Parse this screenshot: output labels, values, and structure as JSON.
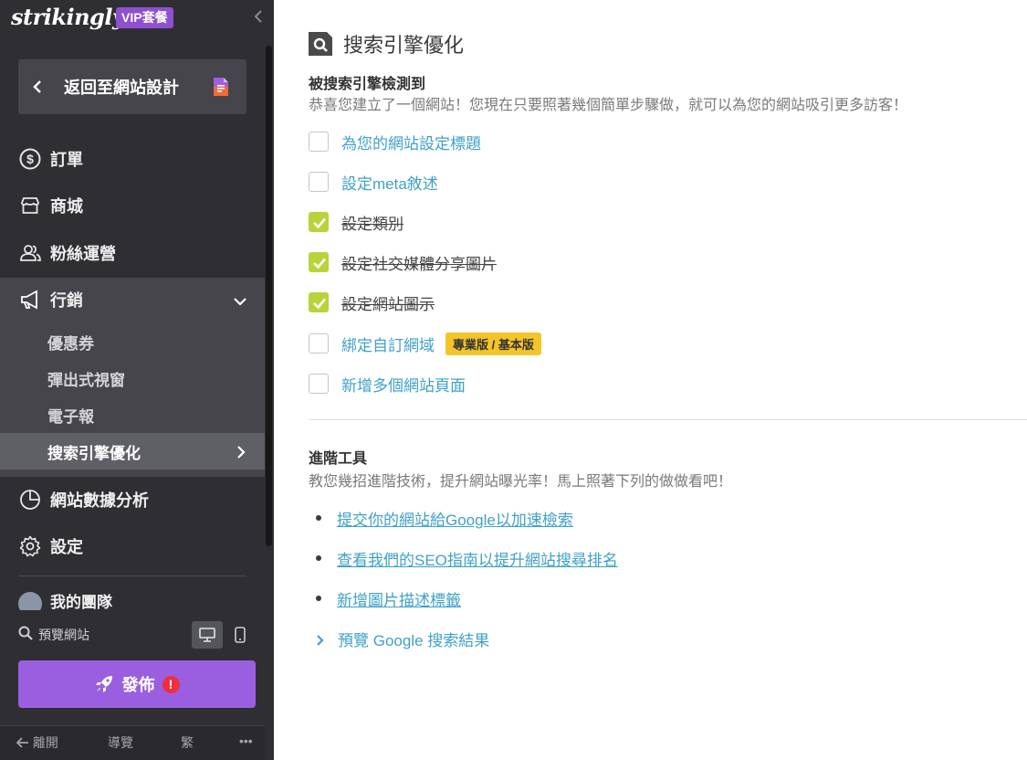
{
  "sidebar": {
    "logo": "strikingly",
    "vip_badge": "VIP套餐",
    "back_label": "返回至網站設計",
    "nav": {
      "orders": "訂單",
      "store": "商城",
      "fans": "粉絲運營",
      "marketing": "行銷",
      "analytics": "網站數據分析",
      "settings": "設定"
    },
    "marketing_sub": {
      "coupons": "優惠券",
      "popup": "彈出式視窗",
      "newsletter": "電子報",
      "seo": "搜索引擎優化"
    },
    "team": "我的團隊",
    "preview_label": "預覽網站",
    "publish_label": "發佈",
    "publish_alert": "!",
    "bottom": {
      "leave": "離開",
      "guide": "導覽",
      "lang": "繁",
      "more": "•••"
    }
  },
  "main": {
    "title": "搜索引擎優化",
    "detect": {
      "heading": "被搜索引擎檢測到",
      "description": "恭喜您建立了一個網站！您現在只要照著幾個簡單步驟做，就可以為您的網站吸引更多訪客！"
    },
    "checklist": [
      {
        "label": "為您的網站設定標題",
        "done": false
      },
      {
        "label": "設定meta敘述",
        "done": false
      },
      {
        "label": "設定類別",
        "done": true
      },
      {
        "label": "設定社交媒體分享圖片",
        "done": true
      },
      {
        "label": "設定網站圖示",
        "done": true
      },
      {
        "label": "綁定自訂網域",
        "done": false,
        "badge": "專業版 / 基本版"
      },
      {
        "label": "新增多個網站頁面",
        "done": false
      }
    ],
    "advanced": {
      "heading": "進階工具",
      "description": "教您幾招進階技術，提升網站曝光率！馬上照著下列的做做看吧！",
      "links": [
        "提交你的網站給Google以加速檢索",
        "查看我們的SEO指南以提升網站搜尋排名",
        "新增圖片描述標籤"
      ],
      "preview_google": "預覽 Google 搜索結果"
    }
  },
  "colors": {
    "sidebar_bg": "#2f2f33",
    "active_bg": "#45454b",
    "accent_purple": "#9a5fe0",
    "link_blue": "#3fa1c7",
    "check_green": "#b8d43a",
    "badge_yellow": "#f4c42b",
    "alert_red": "#ef2f3d"
  },
  "icons": {
    "orders": "dollar-circle-icon",
    "store": "storefront-icon",
    "fans": "people-icon",
    "marketing": "megaphone-icon",
    "analytics": "pie-chart-icon",
    "settings": "gear-icon"
  }
}
